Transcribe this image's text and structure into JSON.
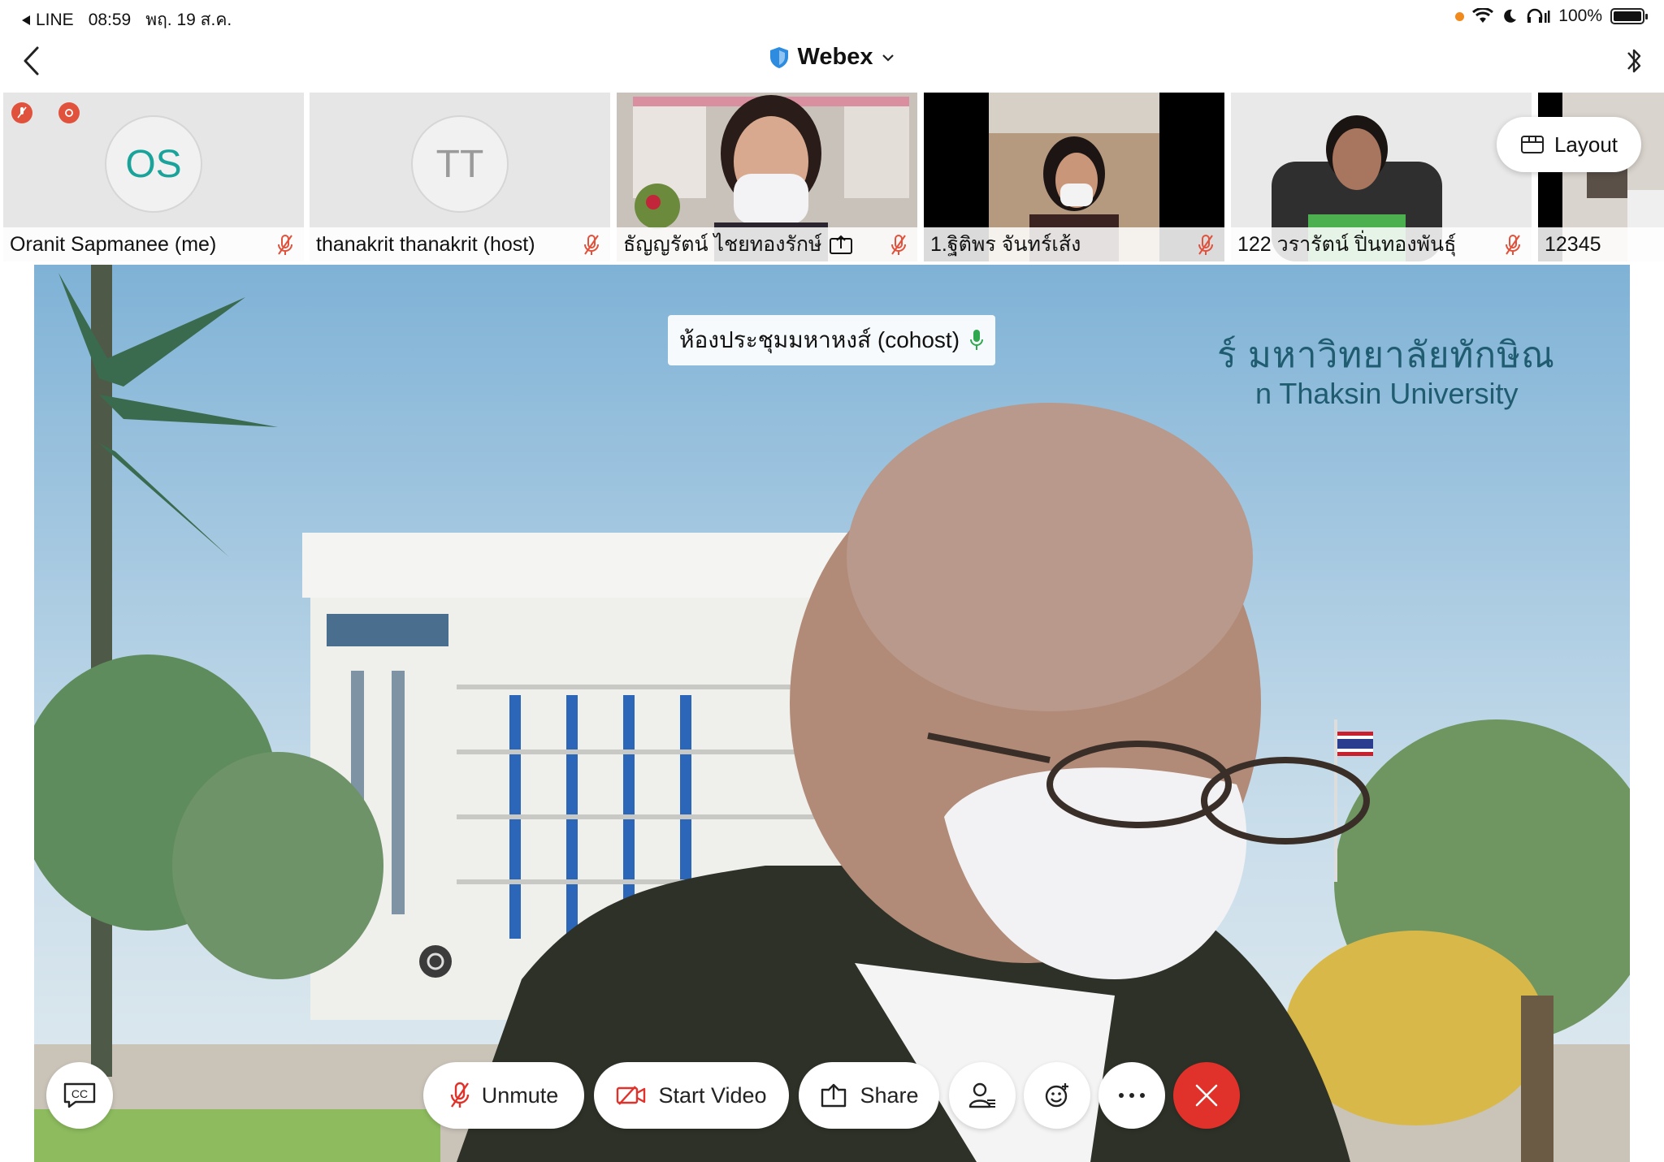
{
  "status_bar": {
    "back_app": "LINE",
    "time": "08:59",
    "date": "พฤ. 19 ส.ค.",
    "battery": "100%"
  },
  "nav": {
    "title": "Webex"
  },
  "participants": [
    {
      "initials": "OS",
      "name": "Oranit Sapmanee (me)",
      "initials_color": "#1aa39a"
    },
    {
      "initials": "TT",
      "name": "thanakrit thanakrit (host)",
      "initials_color": "#9a9a9a"
    },
    {
      "name": "ธัญญรัตน์ ไชยทองรักษ์"
    },
    {
      "name": "1.ฐิติพร จันทร์เส้ง"
    },
    {
      "name": "122 วรารัตน์ ปิ่นทองพันธุ์"
    },
    {
      "name": "12345"
    }
  ],
  "layout_button": {
    "label": "Layout"
  },
  "main": {
    "speaker_name": "ห้องประชุมมหาหงส์ (cohost)",
    "banner_line1": "ร์ มหาวิทยาลัยทักษิณ",
    "banner_line2": "n Thaksin University"
  },
  "controls": {
    "unmute": "Unmute",
    "start_video": "Start Video",
    "share": "Share"
  },
  "colors": {
    "accent_red": "#e0322a",
    "mute_red": "#e0523c",
    "shield_blue": "#2d8be0"
  }
}
